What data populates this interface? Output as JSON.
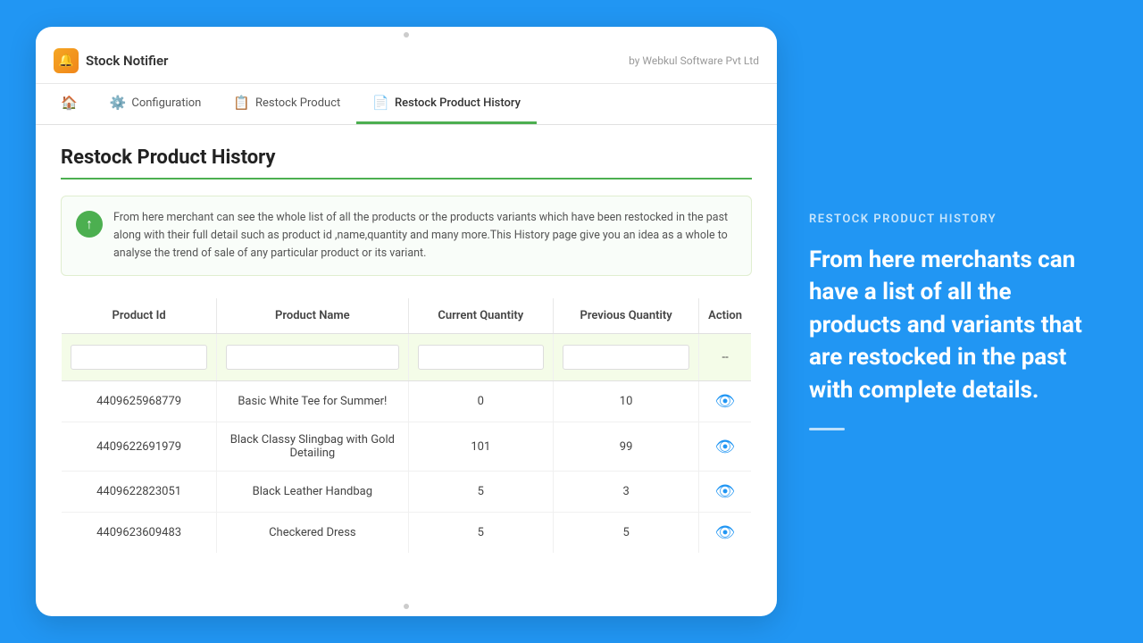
{
  "brand": {
    "name": "Stock Notifier",
    "by": "by Webkul Software Pvt Ltd"
  },
  "nav": {
    "tabs": [
      {
        "id": "home",
        "label": "",
        "icon": "🏠",
        "active": false
      },
      {
        "id": "configuration",
        "label": "Configuration",
        "icon": "⚙️",
        "active": false
      },
      {
        "id": "restock-product",
        "label": "Restock Product",
        "icon": "📋",
        "active": false
      },
      {
        "id": "restock-product-history",
        "label": "Restock Product History",
        "icon": "📄",
        "active": true
      }
    ]
  },
  "page": {
    "title": "Restock Product History",
    "info_text": "From here merchant can see the whole list of all the products or the products variants which have been restocked in the past along with their full detail such as product id ,name,quantity and many more.This History page give you an idea as a whole to analyse the trend of sale of any particular product or its variant."
  },
  "table": {
    "columns": [
      "Product Id",
      "Product Name",
      "Current Quantity",
      "Previous Quantity",
      "Action"
    ],
    "filter_placeholder": "--",
    "rows": [
      {
        "product_id": "4409625968779",
        "product_name": "Basic White Tee for Summer!",
        "current_qty": "0",
        "previous_qty": "10"
      },
      {
        "product_id": "4409622691979",
        "product_name": "Black Classy Slingbag with Gold Detailing",
        "current_qty": "101",
        "previous_qty": "99"
      },
      {
        "product_id": "4409622823051",
        "product_name": "Black Leather Handbag",
        "current_qty": "5",
        "previous_qty": "3"
      },
      {
        "product_id": "4409623609483",
        "product_name": "Checkered Dress",
        "current_qty": "5",
        "previous_qty": "5"
      }
    ]
  },
  "right_panel": {
    "label": "RESTOCK PRODUCT HISTORY",
    "description": "From here merchants can have a list of all the products and variants that are restocked in the past with complete details."
  }
}
